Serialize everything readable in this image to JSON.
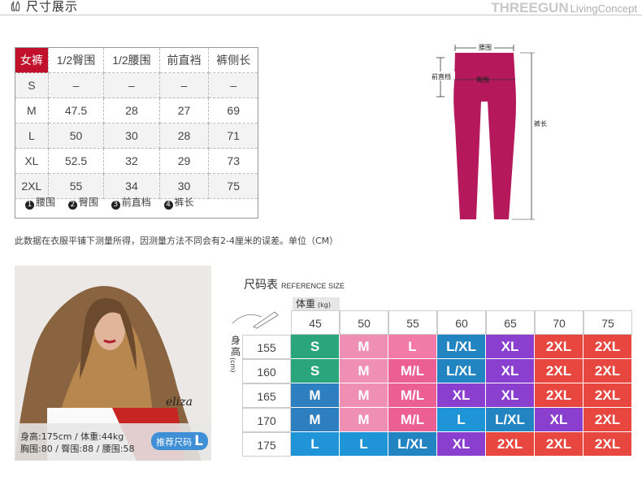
{
  "header": {
    "title": "尺寸展示",
    "brand_main": "THREEGUN",
    "brand_sub": "LivingConcept"
  },
  "size_table": {
    "headers": [
      "女裤",
      "1/2臀围",
      "1/2腰围",
      "前直裆",
      "裤侧长"
    ],
    "rows": [
      [
        "S",
        "–",
        "–",
        "–",
        "–"
      ],
      [
        "M",
        "47.5",
        "28",
        "27",
        "69"
      ],
      [
        "L",
        "50",
        "30",
        "28",
        "71"
      ],
      [
        "XL",
        "52.5",
        "32",
        "29",
        "73"
      ],
      [
        "2XL",
        "55",
        "34",
        "30",
        "75"
      ]
    ],
    "legend": [
      {
        "n": "1",
        "label": "腰围"
      },
      {
        "n": "2",
        "label": "臀围"
      },
      {
        "n": "3",
        "label": "前直档"
      },
      {
        "n": "4",
        "label": "裤长"
      }
    ]
  },
  "diagram": {
    "waist": "腰围",
    "front_rise": "前直档",
    "hip": "臀围",
    "length": "裤长",
    "color": "#b5195c"
  },
  "note": "此数据在衣服平铺下测量所得，因测量方法不同会有2-4厘米的误差。单位（CM）",
  "model": {
    "stats1": "身高:175cm / 体重:44kg",
    "stats2": "胸围:80 / 臀围:88 / 腰围:58",
    "rec_label": "推荐尺码",
    "rec_size": "L",
    "signature": "eliza"
  },
  "reference": {
    "title": "尺码表",
    "title_en": "REFERENCE SIZE",
    "weight_label": "体重",
    "weight_unit": "(kg)",
    "height_label": "身高",
    "height_unit": "(cm)",
    "weights": [
      "45",
      "50",
      "55",
      "60",
      "65",
      "70",
      "75"
    ],
    "heights": [
      "155",
      "160",
      "165",
      "170",
      "175"
    ],
    "sizes": [
      [
        "S",
        "M",
        "L",
        "L/XL",
        "XL",
        "2XL",
        "2XL"
      ],
      [
        "S",
        "M",
        "M/L",
        "L/XL",
        "XL",
        "2XL",
        "2XL"
      ],
      [
        "M",
        "M",
        "M/L",
        "XL",
        "XL",
        "2XL",
        "2XL"
      ],
      [
        "M",
        "M",
        "M/L",
        "L",
        "L/XL",
        "XL",
        "2XL"
      ],
      [
        "L",
        "L",
        "L/XL",
        "XL",
        "2XL",
        "2XL",
        "2XL"
      ]
    ],
    "colors": {
      "S": "#2ba57c",
      "M": "#2e7fbf",
      "M_pink": "#ef8fb3",
      "L": "#f17aa6",
      "L_blue": "#1f95d8",
      "L/XL": "#2384c2",
      "XL": "#8a3fce",
      "2XL": "#e7473e",
      "M/L": "#ec5f93"
    }
  }
}
